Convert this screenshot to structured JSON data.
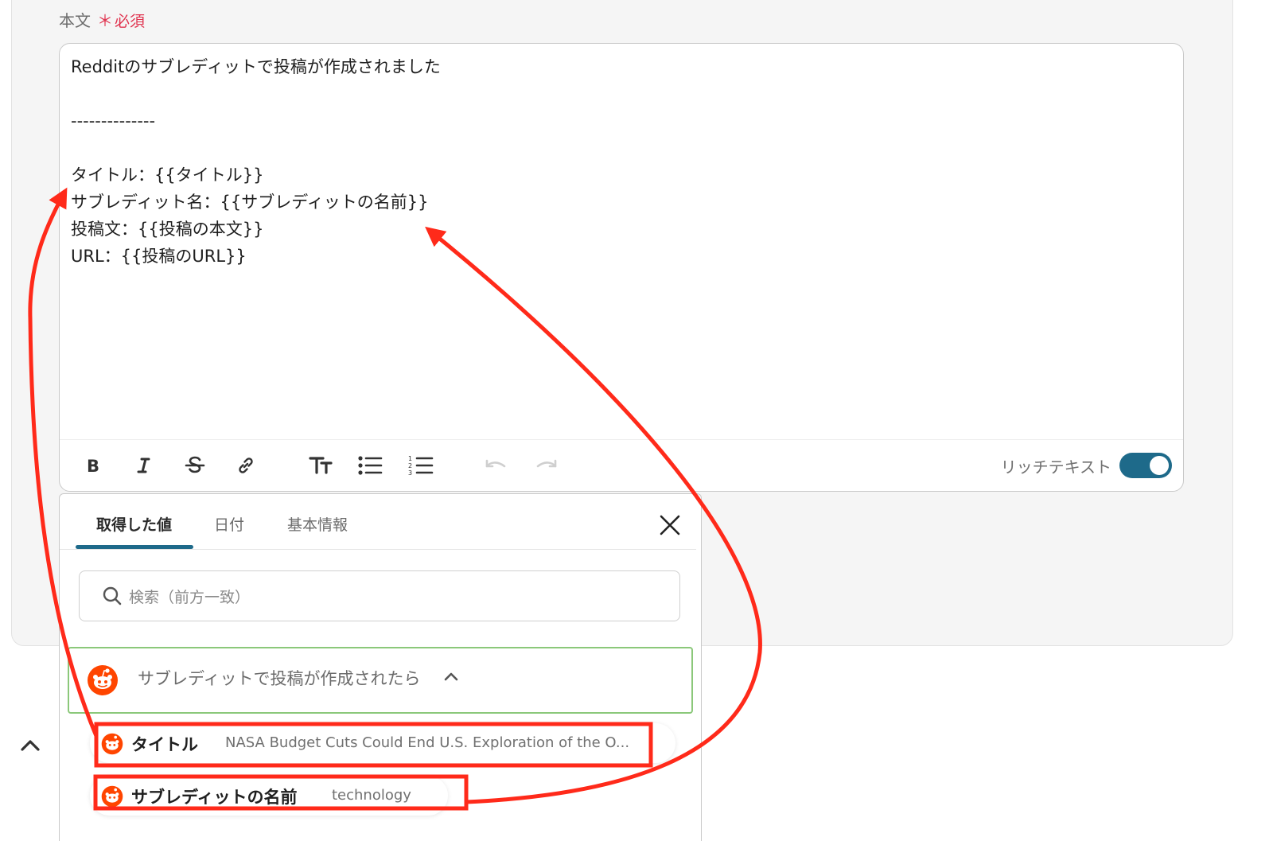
{
  "field": {
    "label": "本文",
    "asterisk": "＊",
    "required": "必須"
  },
  "editor": {
    "lines": [
      "Redditのサブレディットで投稿が作成されました",
      "",
      "--------------",
      "",
      "タイトル：{{タイトル}}",
      "サブレディット名：{{サブレディットの名前}}",
      "投稿文：{{投稿の本文}}",
      "URL：{{投稿のURL}}"
    ],
    "toolbar": {
      "bold_icon": "bold-icon",
      "italic_icon": "italic-icon",
      "strike_icon": "strikethrough-icon",
      "link_icon": "link-icon",
      "heading_icon": "text-size-icon",
      "bullet_icon": "bullet-list-icon",
      "ordered_icon": "numbered-list-icon",
      "undo_icon": "undo-icon",
      "redo_icon": "redo-icon",
      "rich_text_label": "リッチテキスト",
      "rich_text_on": true
    }
  },
  "picker": {
    "tabs": [
      "取得した値",
      "日付",
      "基本情報"
    ],
    "active_tab": 0,
    "search_placeholder": "検索（前方一致）",
    "group": {
      "title": "サブレディットで投稿が作成されたら",
      "icon": "reddit-icon",
      "expanded": true
    },
    "items": [
      {
        "label": "タイトル",
        "value": "NASA Budget Cuts Could End U.S. Exploration of the O..."
      },
      {
        "label": "サブレディットの名前",
        "value": "technology"
      }
    ]
  },
  "colors": {
    "accent": "#1e6a8a",
    "required": "#e0334f",
    "annotation": "#ff2a1a",
    "group_border": "#8bc87a",
    "reddit": "#ff4500"
  }
}
